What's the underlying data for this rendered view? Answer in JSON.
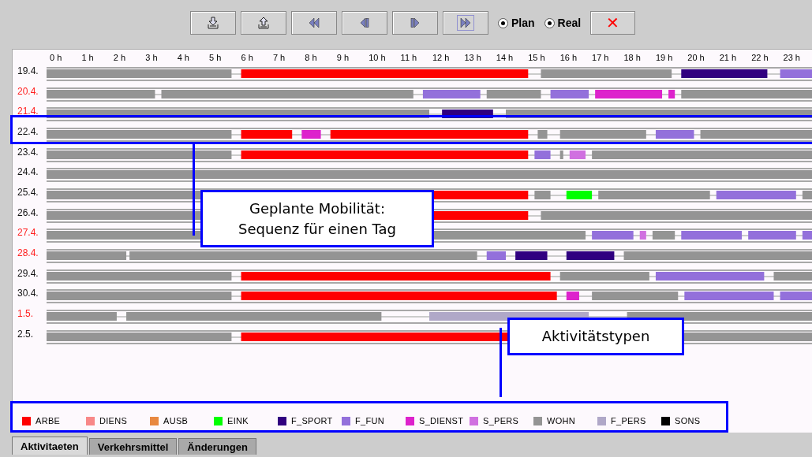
{
  "toolbar": {
    "buttons": [
      {
        "kind": "import",
        "focused": false
      },
      {
        "kind": "export",
        "focused": false
      },
      {
        "kind": "first",
        "focused": false
      },
      {
        "kind": "prev",
        "focused": false
      },
      {
        "kind": "next",
        "focused": false
      },
      {
        "kind": "last",
        "focused": true
      }
    ],
    "radios": [
      {
        "label": "Plan",
        "selected": true
      },
      {
        "label": "Real",
        "selected": true
      }
    ],
    "close": {
      "label": "✕"
    }
  },
  "timeline": {
    "hours": [
      "0 h",
      "1 h",
      "2 h",
      "3 h",
      "4 h",
      "5 h",
      "6 h",
      "7 h",
      "8 h",
      "9 h",
      "10 h",
      "11 h",
      "12 h",
      "13 h",
      "14 h",
      "15 h",
      "16 h",
      "17 h",
      "18 h",
      "19 h",
      "20 h",
      "21 h",
      "22 h",
      "23 h"
    ],
    "rows": [
      {
        "date": "19.4.",
        "weekend": false
      },
      {
        "date": "20.4.",
        "weekend": true
      },
      {
        "date": "21.4.",
        "weekend": true
      },
      {
        "date": "22.4.",
        "weekend": false
      },
      {
        "date": "23.4.",
        "weekend": false
      },
      {
        "date": "24.4.",
        "weekend": false
      },
      {
        "date": "25.4.",
        "weekend": false
      },
      {
        "date": "26.4.",
        "weekend": false
      },
      {
        "date": "27.4.",
        "weekend": true
      },
      {
        "date": "28.4.",
        "weekend": true
      },
      {
        "date": "29.4.",
        "weekend": false
      },
      {
        "date": "30.4.",
        "weekend": false
      },
      {
        "date": "1.5.",
        "weekend": true
      },
      {
        "date": "2.5.",
        "weekend": false
      }
    ]
  },
  "legend": [
    {
      "type": "ARBE",
      "color": "#ff0000"
    },
    {
      "type": "DIENS",
      "color": "#f88888"
    },
    {
      "type": "AUSB",
      "color": "#e88840"
    },
    {
      "type": "EINK",
      "color": "#00ff00"
    },
    {
      "type": "F_SPORT",
      "color": "#300080"
    },
    {
      "type": "F_FUN",
      "color": "#9370db"
    },
    {
      "type": "S_DIENST",
      "color": "#dd22cc"
    },
    {
      "type": "S_PERS",
      "color": "#d070e0"
    },
    {
      "type": "WOHN",
      "color": "#949494"
    },
    {
      "type": "F_PERS",
      "color": "#b0a8c8"
    },
    {
      "type": "SONS",
      "color": "#000000"
    }
  ],
  "annotations": [
    {
      "kind": "row",
      "text": "Geplante Mobilität: Sequenz für einen Tag"
    },
    {
      "kind": "legend",
      "text": "Aktivitätstypen"
    }
  ],
  "tabs": [
    {
      "label": "Aktivitaeten",
      "selected": true
    },
    {
      "label": "Verkehrsmittel",
      "selected": false
    },
    {
      "label": "Änderungen",
      "selected": false
    }
  ]
}
